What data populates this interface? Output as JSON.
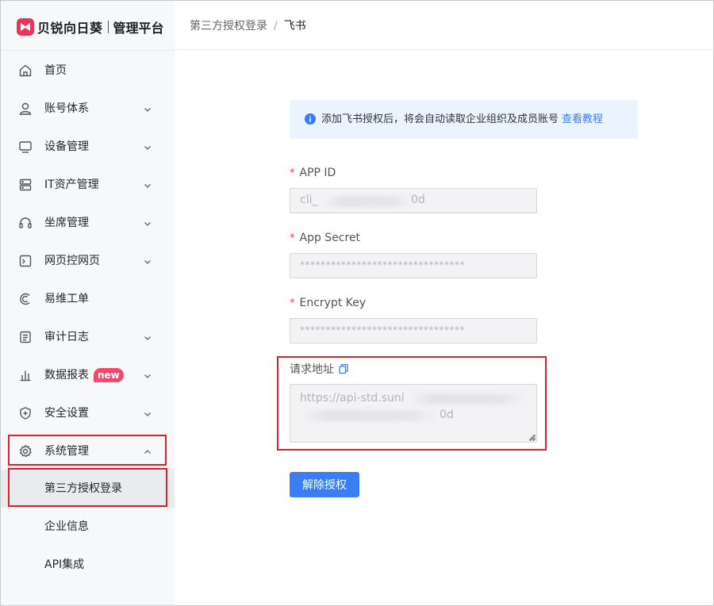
{
  "brand": {
    "name": "贝锐向日葵",
    "product": "管理平台",
    "accent": "#e8335a"
  },
  "sidebar": {
    "items": [
      {
        "label": "首页",
        "icon": "home-icon",
        "expandable": false
      },
      {
        "label": "账号体系",
        "icon": "user-icon",
        "expandable": true
      },
      {
        "label": "设备管理",
        "icon": "monitor-icon",
        "expandable": true
      },
      {
        "label": "IT资产管理",
        "icon": "server-icon",
        "expandable": true
      },
      {
        "label": "坐席管理",
        "icon": "headset-icon",
        "expandable": true
      },
      {
        "label": "网页控网页",
        "icon": "terminal-icon",
        "expandable": true
      },
      {
        "label": "易维工单",
        "icon": "ticket-icon",
        "expandable": false
      },
      {
        "label": "审计日志",
        "icon": "log-icon",
        "expandable": true
      },
      {
        "label": "数据报表",
        "icon": "bar-chart-icon",
        "expandable": true,
        "badge": "new"
      },
      {
        "label": "安全设置",
        "icon": "shield-icon",
        "expandable": true
      },
      {
        "label": "系统管理",
        "icon": "gear-icon",
        "expandable": true,
        "expanded": true
      }
    ],
    "sub_items": [
      {
        "label": "第三方授权登录",
        "active": true
      },
      {
        "label": "企业信息",
        "active": false
      },
      {
        "label": "API集成",
        "active": false
      }
    ]
  },
  "breadcrumb": {
    "parent": "第三方授权登录",
    "separator": "/",
    "current": "飞书"
  },
  "notice": {
    "text": "添加飞书授权后，将会自动读取企业组织及成员账号",
    "link": "查看教程",
    "color": "#3b7cf5"
  },
  "form": {
    "app_id": {
      "label": "APP ID",
      "value_prefix": "cli_",
      "value_suffix": "0d"
    },
    "app_secret": {
      "label": "App Secret",
      "value": "********************************"
    },
    "encrypt_key": {
      "label": "Encrypt Key",
      "value": "********************************"
    },
    "request_url": {
      "label": "请求地址",
      "value_prefix": "https://api-std.sunl",
      "value_suffix": "0d"
    },
    "unbind_button": "解除授权"
  }
}
